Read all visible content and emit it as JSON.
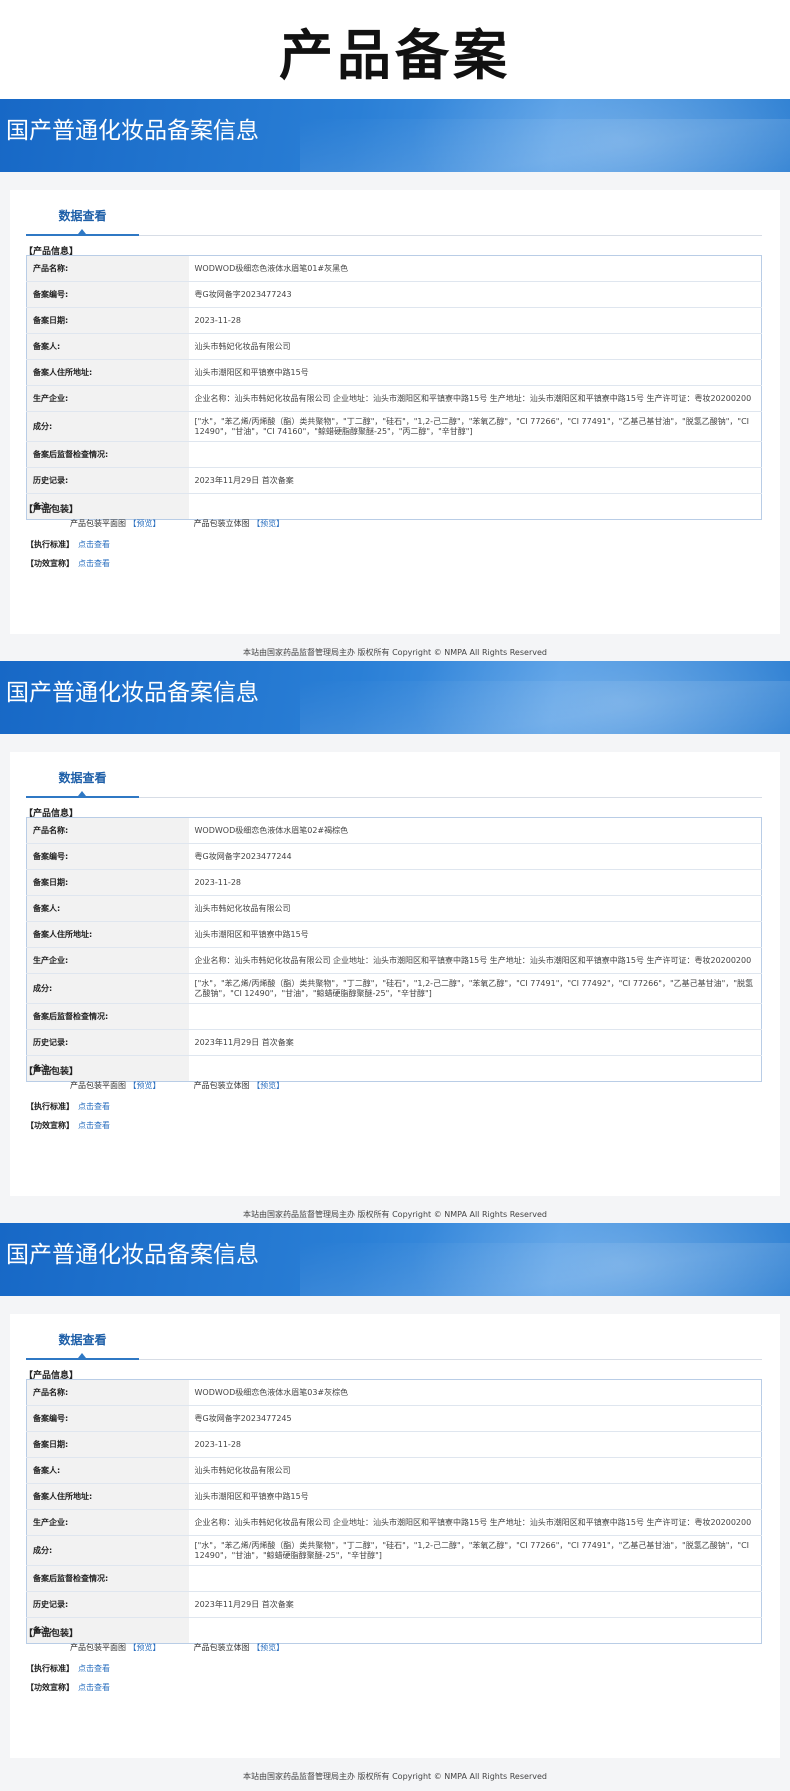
{
  "page_title": "产品备案",
  "records": [
    {
      "banner_title": "国产普通化妆品备案信息",
      "tab_label": "数据查看",
      "product_info_label": "【产品信息】",
      "rows": [
        {
          "k": "产品名称:",
          "v": "WODWOD极细恋色液体水眉笔01#灰黑色"
        },
        {
          "k": "备案编号:",
          "v": "粤G妆网备字2023477243"
        },
        {
          "k": "备案日期:",
          "v": "2023-11-28"
        },
        {
          "k": "备案人:",
          "v": "汕头市韩妃化妆品有限公司"
        },
        {
          "k": "备案人住所地址:",
          "v": "汕头市潮阳区和平镇寮中路15号"
        },
        {
          "k": "生产企业:",
          "v": "企业名称：汕头市韩妃化妆品有限公司 企业地址：汕头市潮阳区和平镇寮中路15号 生产地址：汕头市潮阳区和平镇寮中路15号 生产许可证：粤妆20200200"
        },
        {
          "k": "成分:",
          "v": "[\"水\"，\"苯乙烯/丙烯酸（酯）类共聚物\"，\"丁二醇\"，\"硅石\"，\"1,2-己二醇\"，\"苯氧乙醇\"，\"CI 77266\"，\"CI 77491\"，\"乙基己基甘油\"，\"脱氢乙酸钠\"，\"CI 12490\"，\"甘油\"，\"CI 74160\"，\"鲸蜡硬脂醇聚醚-25\"，\"丙二醇\"，\"辛甘醇\"]"
        },
        {
          "k": "备案后监督检查情况:",
          "v": ""
        },
        {
          "k": "历史记录:",
          "v": "2023年11月29日 首次备案"
        },
        {
          "k": "备注:",
          "v": ""
        }
      ],
      "package_label": "【产品包装】",
      "pkg_flat": "产品包装平面图",
      "pkg_3d": "产品包装立体图",
      "preview": "【预览】",
      "standard_label": "【执行标准】",
      "efficacy_label": "【功效宣称】",
      "view_link": "点击查看",
      "footer": "本站由国家药品监督管理局主办 版权所有 Copyright © NMPA All Rights Reserved"
    },
    {
      "banner_title": "国产普通化妆品备案信息",
      "tab_label": "数据查看",
      "product_info_label": "【产品信息】",
      "rows": [
        {
          "k": "产品名称:",
          "v": "WODWOD极细恋色液体水眉笔02#褐棕色"
        },
        {
          "k": "备案编号:",
          "v": "粤G妆网备字2023477244"
        },
        {
          "k": "备案日期:",
          "v": "2023-11-28"
        },
        {
          "k": "备案人:",
          "v": "汕头市韩妃化妆品有限公司"
        },
        {
          "k": "备案人住所地址:",
          "v": "汕头市潮阳区和平镇寮中路15号"
        },
        {
          "k": "生产企业:",
          "v": "企业名称：汕头市韩妃化妆品有限公司 企业地址：汕头市潮阳区和平镇寮中路15号 生产地址：汕头市潮阳区和平镇寮中路15号 生产许可证：粤妆20200200"
        },
        {
          "k": "成分:",
          "v": "[\"水\"，\"苯乙烯/丙烯酸（酯）类共聚物\"，\"丁二醇\"，\"硅石\"，\"1,2-己二醇\"，\"苯氧乙醇\"，\"CI 77491\"，\"CI 77492\"，\"CI 77266\"，\"乙基己基甘油\"，\"脱氢乙酸钠\"，\"CI 12490\"，\"甘油\"，\"鲸蜡硬脂醇聚醚-25\"，\"辛甘醇\"]"
        },
        {
          "k": "备案后监督检查情况:",
          "v": ""
        },
        {
          "k": "历史记录:",
          "v": "2023年11月29日 首次备案"
        },
        {
          "k": "备注:",
          "v": ""
        }
      ],
      "package_label": "【产品包装】",
      "pkg_flat": "产品包装平面图",
      "pkg_3d": "产品包装立体图",
      "preview": "【预览】",
      "standard_label": "【执行标准】",
      "efficacy_label": "【功效宣称】",
      "view_link": "点击查看",
      "footer": "本站由国家药品监督管理局主办 版权所有 Copyright © NMPA All Rights Reserved"
    },
    {
      "banner_title": "国产普通化妆品备案信息",
      "tab_label": "数据查看",
      "product_info_label": "【产品信息】",
      "rows": [
        {
          "k": "产品名称:",
          "v": "WODWOD极细恋色液体水眉笔03#灰棕色"
        },
        {
          "k": "备案编号:",
          "v": "粤G妆网备字2023477245"
        },
        {
          "k": "备案日期:",
          "v": "2023-11-28"
        },
        {
          "k": "备案人:",
          "v": "汕头市韩妃化妆品有限公司"
        },
        {
          "k": "备案人住所地址:",
          "v": "汕头市潮阳区和平镇寮中路15号"
        },
        {
          "k": "生产企业:",
          "v": "企业名称：汕头市韩妃化妆品有限公司 企业地址：汕头市潮阳区和平镇寮中路15号 生产地址：汕头市潮阳区和平镇寮中路15号 生产许可证：粤妆20200200"
        },
        {
          "k": "成分:",
          "v": "[\"水\"，\"苯乙烯/丙烯酸（酯）类共聚物\"，\"丁二醇\"，\"硅石\"，\"1,2-己二醇\"，\"苯氧乙醇\"，\"CI 77266\"，\"CI 77491\"，\"乙基己基甘油\"，\"脱氢乙酸钠\"，\"CI 12490\"，\"甘油\"，\"鲸蜡硬脂醇聚醚-25\"，\"辛甘醇\"]"
        },
        {
          "k": "备案后监督检查情况:",
          "v": ""
        },
        {
          "k": "历史记录:",
          "v": "2023年11月29日 首次备案"
        },
        {
          "k": "备注:",
          "v": ""
        }
      ],
      "package_label": "【产品包装】",
      "pkg_flat": "产品包装平面图",
      "pkg_3d": "产品包装立体图",
      "preview": "【预览】",
      "standard_label": "【执行标准】",
      "efficacy_label": "【功效宣称】",
      "view_link": "点击查看",
      "footer": "本站由国家药品监督管理局主办 版权所有 Copyright © NMPA All Rights Reserved"
    }
  ]
}
